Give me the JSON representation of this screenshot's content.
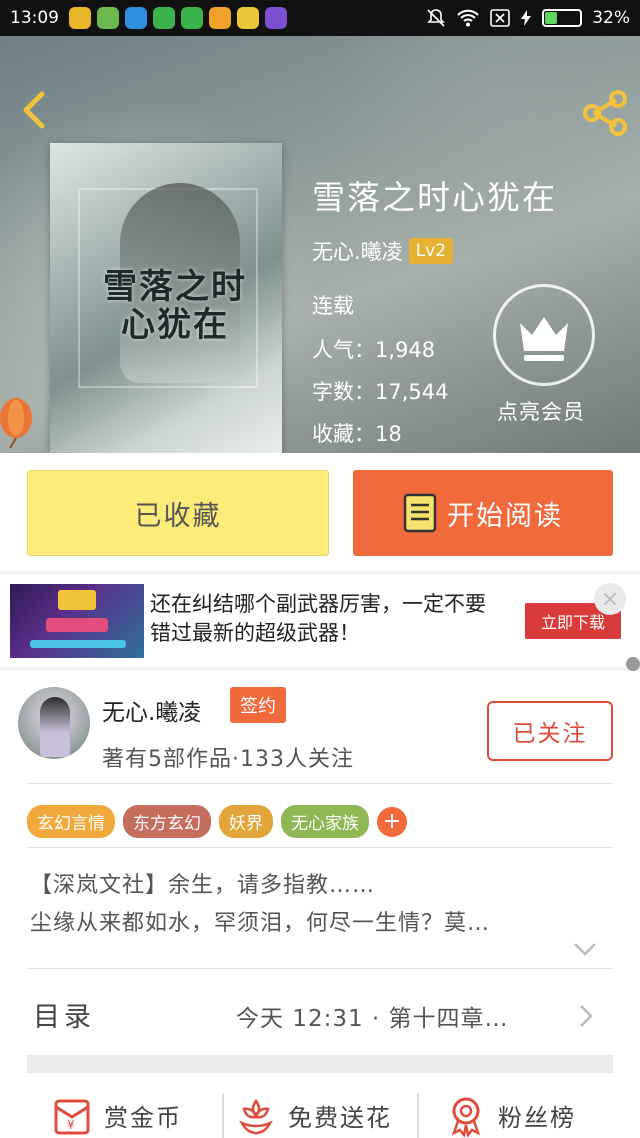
{
  "status_bar": {
    "time": "13:09",
    "battery": "32%",
    "battery_level": 0.32
  },
  "book": {
    "title": "雪落之时心犹在",
    "author": "无心.曦凌",
    "level": "Lv2",
    "status": "连载",
    "popularity": "人气：1,948",
    "word_count": "字数：17,544",
    "collections": "收藏：18",
    "vip_label": "点亮会员",
    "cover_text": "雪落之时 心犹在"
  },
  "actions": {
    "favorited_label": "已收藏",
    "read_label": "开始阅读"
  },
  "ad": {
    "text": "还在纠结哪个副武器厉害，一定不要错过最新的超级武器！",
    "button_label": "立即下载",
    "close_symbol": "×"
  },
  "author_info": {
    "name": "无心.曦凌",
    "badge": "签约",
    "stats": "著有5部作品·133人关注",
    "follow_label": "已关注"
  },
  "tags": [
    {
      "label": "玄幻言情",
      "color": "#f2a93b"
    },
    {
      "label": "东方玄幻",
      "color": "#c66e5e"
    },
    {
      "label": "妖界",
      "color": "#e3a53a"
    },
    {
      "label": "无心家族",
      "color": "#8db853"
    }
  ],
  "tag_add": "+",
  "intro": {
    "line1": "【深岚文社】余生，请多指教……",
    "line2": "尘缘从来都如水，罕须泪，何尽一生情？莫…"
  },
  "toc": {
    "label": "目录",
    "latest": "今天 12:31 · 第十四章…"
  },
  "bottom_bar": {
    "reward": "赏金币",
    "flower": "免费送花",
    "fans": "粉丝榜"
  },
  "colors": {
    "accent": "#f06a3c",
    "favorite_bg": "#fbec7a",
    "follow": "#e04b3a"
  }
}
